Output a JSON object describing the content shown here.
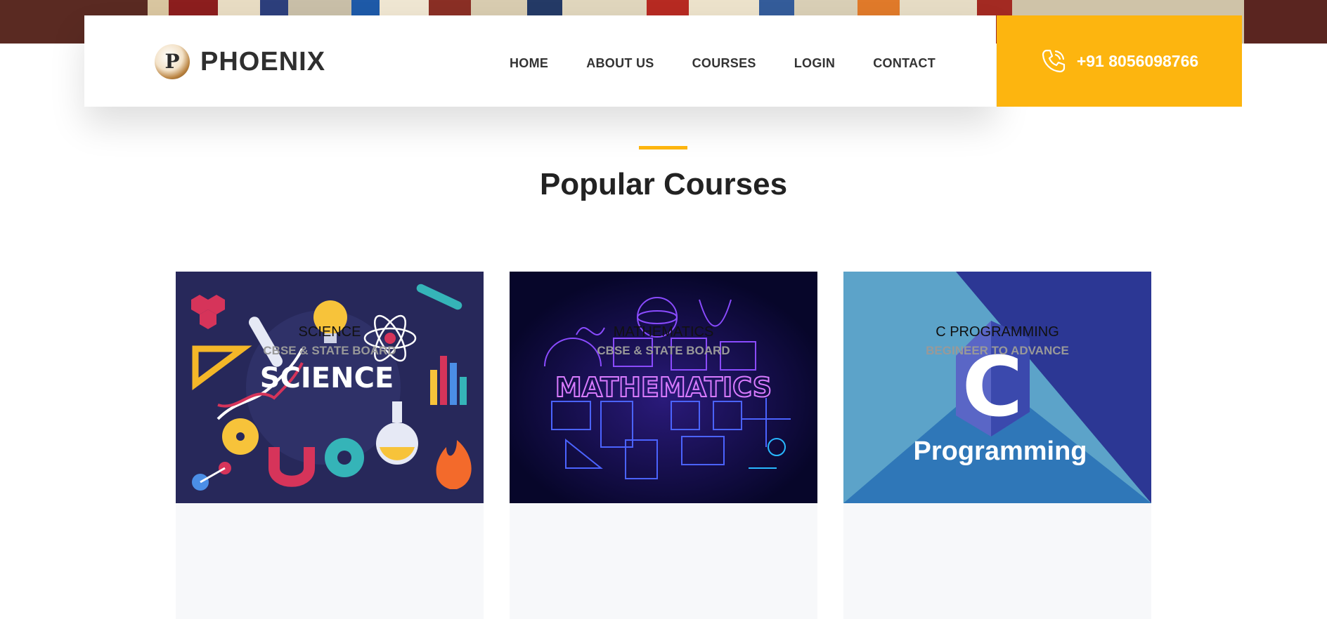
{
  "brand": {
    "logo_glyph": "P",
    "name": "PHOENIX",
    "accent_color": "#fdb50f"
  },
  "nav": {
    "items": [
      "HOME",
      "ABOUT US",
      "COURSES",
      "LOGIN",
      "CONTACT"
    ]
  },
  "contact": {
    "phone": "+91 8056098766",
    "icon": "phone-icon"
  },
  "section": {
    "title": "Popular Courses"
  },
  "courses": [
    {
      "title": "SCIENCE",
      "subtitle": "CBSE & STATE BOARD",
      "image_text": "SCIENCE"
    },
    {
      "title": "MATHEMATICS",
      "subtitle": "CBSE & STATE BOARD",
      "image_text": "MATHEMATICS"
    },
    {
      "title": "C PROGRAMMING",
      "subtitle": "BEGINEER TO ADVANCE",
      "image_text": "Programming",
      "image_letter": "C"
    }
  ]
}
